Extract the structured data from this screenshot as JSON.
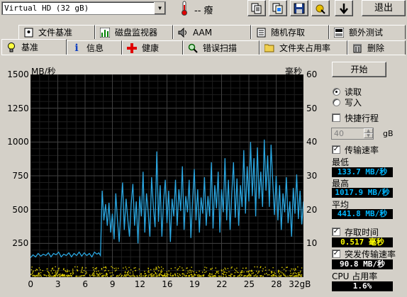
{
  "toolbar": {
    "drive": "Virtual HD (32 gB)",
    "temperature": "-- 癈",
    "exit_label": "退出"
  },
  "tabs_top": [
    {
      "label": "文件基准",
      "icon": "file-benchmark-icon"
    },
    {
      "label": "磁盘监视器",
      "icon": "disk-monitor-icon"
    },
    {
      "label": "AAM",
      "icon": "speaker-icon"
    },
    {
      "label": "随机存取",
      "icon": "random-access-icon"
    },
    {
      "label": "额外测试",
      "icon": "extra-tests-icon"
    }
  ],
  "tabs_bottom": [
    {
      "label": "基准",
      "icon": "lightbulb-icon"
    },
    {
      "label": "信息",
      "icon": "info-icon"
    },
    {
      "label": "健康",
      "icon": "health-cross-icon"
    },
    {
      "label": "错误扫描",
      "icon": "magnifier-icon"
    },
    {
      "label": "文件夹占用率",
      "icon": "folder-icon"
    },
    {
      "label": "删除",
      "icon": "trash-icon"
    }
  ],
  "controls": {
    "start_label": "开始",
    "read_label": "读取",
    "write_label": "写入",
    "short_stroke_label": "快捷行程",
    "short_stroke_value": "40",
    "short_stroke_unit": "gB",
    "transfer_rate_label": "传输速率",
    "min_label": "最低",
    "min_value": "133.7 MB/秒",
    "max_label": "最高",
    "max_value": "1017.9 MB/秒",
    "avg_label": "平均",
    "avg_value": "441.8 MB/秒",
    "access_time_label": "存取时间",
    "access_time_value": "0.517 毫秒",
    "burst_label": "突发传输速率",
    "burst_value": "90.8 MB/秒",
    "cpu_label": "CPU 占用率",
    "cpu_value": "1.6%"
  },
  "colors": {
    "transfer_line": "#2aa6e0",
    "access_points": "#e0d000",
    "grid": "#404040",
    "background": "#000000"
  },
  "chart_data": {
    "type": "line",
    "left_axis_label": "MB/秒",
    "right_axis_label": "毫秒",
    "x_unit": "gB",
    "ylim": [
      0,
      1500
    ],
    "y2lim": [
      0,
      60
    ],
    "xlim": [
      0,
      32
    ],
    "x_ticks": [
      "0",
      "3",
      "6",
      "9",
      "12",
      "16",
      "19",
      "22",
      "25",
      "28",
      "32gB"
    ],
    "y_ticks": [
      "1500",
      "1250",
      "1000",
      "750",
      "500",
      "250"
    ],
    "y2_ticks": [
      "60",
      "50",
      "40",
      "30",
      "20",
      "10"
    ],
    "grid": true,
    "series": [
      {
        "kind": "transfer",
        "values": [
          [
            0.0,
            145
          ],
          [
            0.3,
            165
          ],
          [
            0.6,
            150
          ],
          [
            0.9,
            175
          ],
          [
            1.2,
            155
          ],
          [
            1.5,
            170
          ],
          [
            1.8,
            160
          ],
          [
            2.1,
            180
          ],
          [
            2.4,
            150
          ],
          [
            2.7,
            175
          ],
          [
            3.0,
            165
          ],
          [
            3.3,
            185
          ],
          [
            3.6,
            150
          ],
          [
            3.9,
            170
          ],
          [
            4.2,
            160
          ],
          [
            4.5,
            180
          ],
          [
            4.8,
            150
          ],
          [
            5.1,
            175
          ],
          [
            5.4,
            160
          ],
          [
            5.7,
            185
          ],
          [
            6.0,
            155
          ],
          [
            6.3,
            180
          ],
          [
            6.6,
            160
          ],
          [
            6.9,
            175
          ],
          [
            7.2,
            150
          ],
          [
            7.5,
            185
          ],
          [
            7.8,
            170
          ],
          [
            8.0,
            180
          ],
          [
            8.2,
            160
          ],
          [
            8.4,
            640
          ],
          [
            8.6,
            420
          ],
          [
            8.8,
            540
          ],
          [
            9.0,
            380
          ],
          [
            9.2,
            550
          ],
          [
            9.4,
            330
          ],
          [
            9.6,
            470
          ],
          [
            9.8,
            280
          ],
          [
            10.0,
            620
          ],
          [
            10.2,
            420
          ],
          [
            10.4,
            260
          ],
          [
            10.6,
            510
          ],
          [
            10.8,
            700
          ],
          [
            11.0,
            350
          ],
          [
            11.2,
            580
          ],
          [
            11.4,
            430
          ],
          [
            11.6,
            300
          ],
          [
            11.8,
            540
          ],
          [
            12.0,
            690
          ],
          [
            12.2,
            380
          ],
          [
            12.4,
            560
          ],
          [
            12.6,
            250
          ],
          [
            12.8,
            600
          ],
          [
            13.0,
            450
          ],
          [
            13.2,
            780
          ],
          [
            13.4,
            330
          ],
          [
            13.6,
            620
          ],
          [
            13.8,
            480
          ],
          [
            14.0,
            300
          ],
          [
            14.2,
            740
          ],
          [
            14.4,
            520
          ],
          [
            14.6,
            370
          ],
          [
            14.8,
            930
          ],
          [
            15.0,
            410
          ],
          [
            15.2,
            680
          ],
          [
            15.4,
            300
          ],
          [
            15.6,
            560
          ],
          [
            15.8,
            720
          ],
          [
            16.0,
            400
          ],
          [
            16.2,
            640
          ],
          [
            16.4,
            260
          ],
          [
            16.6,
            580
          ],
          [
            16.8,
            450
          ],
          [
            17.0,
            720
          ],
          [
            17.2,
            380
          ],
          [
            17.4,
            650
          ],
          [
            17.6,
            490
          ],
          [
            17.8,
            820
          ],
          [
            18.0,
            350
          ],
          [
            18.2,
            600
          ],
          [
            18.4,
            480
          ],
          [
            18.6,
            720
          ],
          [
            18.8,
            290
          ],
          [
            19.0,
            560
          ],
          [
            19.2,
            800
          ],
          [
            19.4,
            420
          ],
          [
            19.6,
            650
          ],
          [
            19.8,
            330
          ],
          [
            20.0,
            590
          ],
          [
            20.2,
            470
          ],
          [
            20.4,
            740
          ],
          [
            20.6,
            380
          ],
          [
            20.8,
            600
          ],
          [
            21.0,
            450
          ],
          [
            21.2,
            850
          ],
          [
            21.4,
            360
          ],
          [
            21.6,
            680
          ],
          [
            21.8,
            510
          ],
          [
            22.0,
            780
          ],
          [
            22.2,
            330
          ],
          [
            22.4,
            650
          ],
          [
            22.6,
            480
          ],
          [
            22.8,
            880
          ],
          [
            23.0,
            420
          ],
          [
            23.2,
            720
          ],
          [
            23.4,
            350
          ],
          [
            23.6,
            620
          ],
          [
            23.8,
            850
          ],
          [
            24.0,
            440
          ],
          [
            24.2,
            730
          ],
          [
            24.4,
            380
          ],
          [
            24.6,
            680
          ],
          [
            24.8,
            520
          ],
          [
            25.0,
            940
          ],
          [
            25.2,
            470
          ],
          [
            25.4,
            820
          ],
          [
            25.6,
            560
          ],
          [
            25.8,
            1000
          ],
          [
            26.0,
            600
          ],
          [
            26.2,
            880
          ],
          [
            26.4,
            450
          ],
          [
            26.6,
            960
          ],
          [
            26.8,
            580
          ],
          [
            27.0,
            780
          ],
          [
            27.2,
            520
          ],
          [
            27.4,
            1018
          ],
          [
            27.6,
            640
          ],
          [
            27.8,
            900
          ],
          [
            28.0,
            520
          ],
          [
            28.2,
            980
          ],
          [
            28.4,
            700
          ],
          [
            28.6,
            460
          ],
          [
            28.8,
            750
          ],
          [
            29.0,
            420
          ],
          [
            29.2,
            680
          ],
          [
            29.4,
            350
          ],
          [
            29.6,
            620
          ],
          [
            29.8,
            480
          ],
          [
            30.0,
            740
          ],
          [
            30.2,
            400
          ],
          [
            30.4,
            560
          ],
          [
            30.6,
            300
          ],
          [
            30.8,
            660
          ],
          [
            31.0,
            470
          ],
          [
            31.2,
            760
          ],
          [
            31.4,
            430
          ],
          [
            31.6,
            640
          ],
          [
            31.8,
            390
          ],
          [
            32.0,
            560
          ]
        ]
      },
      {
        "kind": "access_time",
        "note_range": [
          0.2,
          1.5
        ]
      }
    ]
  }
}
